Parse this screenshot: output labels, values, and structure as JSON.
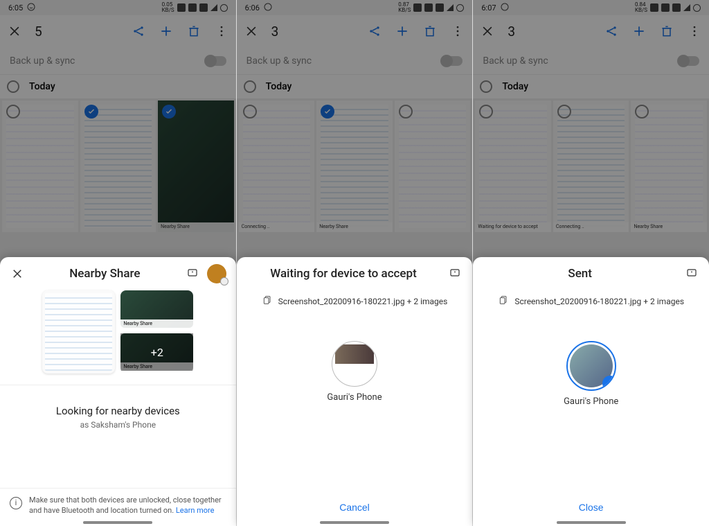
{
  "phones": [
    {
      "status": {
        "time": "6:05",
        "speed": "0.05",
        "unit": "KB/S"
      },
      "toolbar_count": "5",
      "backup_label": "Back up & sync",
      "section_label": "Today",
      "sheet": {
        "title": "Nearby Share",
        "more_overlay": "+2",
        "thumb_label": "Nearby Share",
        "looking_title": "Looking for nearby devices",
        "looking_sub": "as Saksham's Phone",
        "notice_text": "Make sure that both devices are unlocked, close together and have Bluetooth and location turned on. ",
        "notice_link": "Learn more"
      }
    },
    {
      "status": {
        "time": "6:06",
        "speed": "0.87",
        "unit": "KB/S"
      },
      "toolbar_count": "3",
      "backup_label": "Back up & sync",
      "section_label": "Today",
      "sheet": {
        "title": "Waiting for device to accept",
        "file_line": "Screenshot_20200916-180221.jpg + 2 images",
        "device_name": "Gauri's Phone",
        "action_label": "Cancel"
      }
    },
    {
      "status": {
        "time": "6:07",
        "speed": "0.84",
        "unit": "KB/S"
      },
      "toolbar_count": "3",
      "backup_label": "Back up & sync",
      "section_label": "Today",
      "sheet": {
        "title": "Sent",
        "file_line": "Screenshot_20200916-180221.jpg + 2 images",
        "device_name": "Gauri's Phone",
        "action_label": "Close"
      }
    }
  ]
}
